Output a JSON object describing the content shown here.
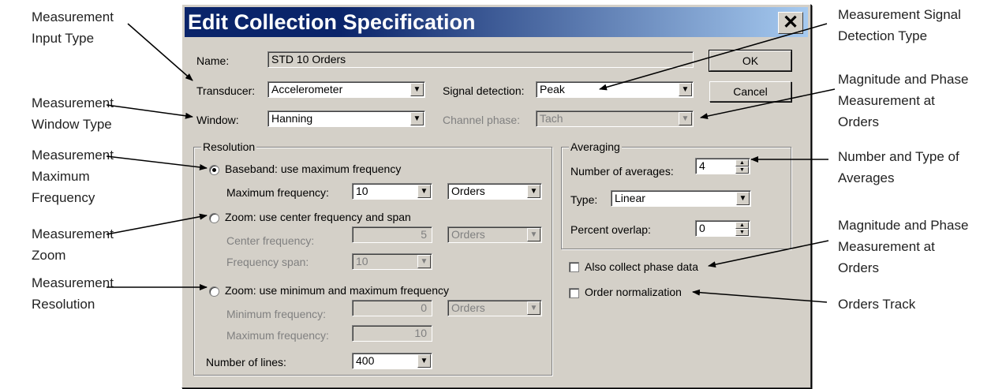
{
  "callouts": {
    "input_type": "Measurement\nInput Type",
    "window_type": "Measurement\nWindow Type",
    "max_frequency": "Measurement\nMaximum\nFrequency",
    "zoom": "Measurement\nZoom",
    "resolution": "Measurement\nResolution",
    "signal_detection": "Measurement Signal\nDetection Type",
    "mag_phase_top": "Magnitude and Phase\nMeasurement at\nOrders",
    "averages": "Number and Type of\nAverages",
    "mag_phase_mid": "Magnitude and Phase\nMeasurement at\nOrders",
    "orders_track": "Orders Track"
  },
  "dialog": {
    "title": "Edit Collection Specification",
    "close_glyph": "✕",
    "ok_label": "OK",
    "cancel_label": "Cancel",
    "name_label": "Name:",
    "name_value": "STD 10 Orders",
    "transducer_label": "Transducer:",
    "transducer_value": "Accelerometer",
    "signal_label": "Signal detection:",
    "signal_value": "Peak",
    "window_label": "Window:",
    "window_value": "Hanning",
    "phase_label": "Channel phase:",
    "phase_value": "Tach",
    "resolution": {
      "legend": "Resolution",
      "baseband_label": "Baseband: use maximum frequency",
      "max_freq_label": "Maximum frequency:",
      "max_freq_value": "10",
      "max_freq_unit": "Orders",
      "zoom_center_label": "Zoom: use center frequency and span",
      "center_freq_label": "Center frequency:",
      "center_freq_value": "5",
      "center_freq_unit": "Orders",
      "span_label": "Frequency span:",
      "span_value": "10",
      "zoom_minmax_label": "Zoom: use minimum and maximum frequency",
      "min_freq_label": "Minimum frequency:",
      "min_freq_value": "0",
      "min_freq_unit": "Orders",
      "max2_label": "Maximum frequency:",
      "max2_value": "10",
      "lines_label": "Number of lines:",
      "lines_value": "400"
    },
    "averaging": {
      "legend": "Averaging",
      "num_label": "Number of averages:",
      "num_value": "4",
      "type_label": "Type:",
      "type_value": "Linear",
      "overlap_label": "Percent overlap:",
      "overlap_value": "0"
    },
    "phase_data_label": "Also collect phase data",
    "order_norm_label": "Order normalization",
    "dropdown_glyph": "▼",
    "spin_up": "▲",
    "spin_down": "▼"
  }
}
